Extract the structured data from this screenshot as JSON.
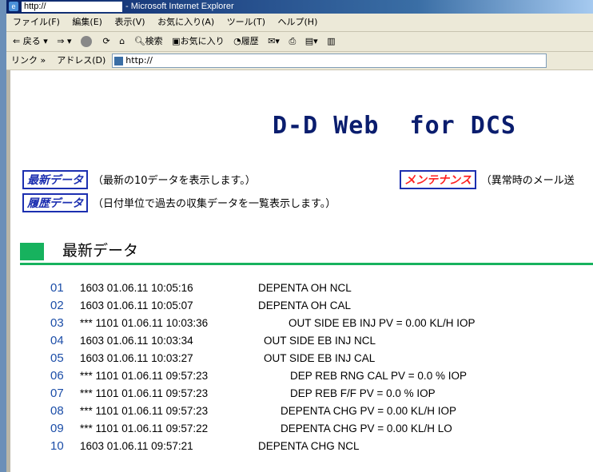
{
  "window": {
    "url": "http://",
    "app_title": "- Microsoft Internet Explorer"
  },
  "menu": [
    "ファイル(F)",
    "編集(E)",
    "表示(V)",
    "お気に入り(A)",
    "ツール(T)",
    "ヘルプ(H)"
  ],
  "toolbar": {
    "back": "戻る",
    "search": "検索",
    "favorites": "お気に入り",
    "history": "履歴"
  },
  "address": {
    "links_label": "リンク »",
    "address_label": "アドレス(D)",
    "value": "http://"
  },
  "page": {
    "brand": "D-D Web  for DCS",
    "latest_link": "最新データ",
    "latest_desc": "（最新の10データを表示します。）",
    "history_link": "履歴データ",
    "history_desc": "（日付単位で過去の収集データを一覧表示します。）",
    "maintenance_link": "メンテナンス",
    "maintenance_desc": "（異常時のメール送",
    "section_heading": "最新データ"
  },
  "rows": [
    {
      "num": "01",
      "code": "1603 01.06.11 10:05:16",
      "msg": "DEPENTA OH NCL"
    },
    {
      "num": "02",
      "code": "1603 01.06.11 10:05:07",
      "msg": "DEPENTA OH CAL"
    },
    {
      "num": "03",
      "code": "*** 1101 01.06.11 10:03:36",
      "msg": "OUT SIDE EB INJ PV = 0.00 KL/H IOP"
    },
    {
      "num": "04",
      "code": "1603 01.06.11 10:03:34",
      "msg": "OUT SIDE EB INJ NCL"
    },
    {
      "num": "05",
      "code": "1603 01.06.11 10:03:27",
      "msg": "OUT SIDE EB INJ CAL"
    },
    {
      "num": "06",
      "code": "*** 1101 01.06.11 09:57:23",
      "msg": "DEP REB RNG CAL PV = 0.0 % IOP"
    },
    {
      "num": "07",
      "code": "*** 1101 01.06.11 09:57:23",
      "msg": "DEP REB F/F PV = 0.0 % IOP"
    },
    {
      "num": "08",
      "code": "*** 1101 01.06.11 09:57:23",
      "msg": "DEPENTA CHG PV = 0.00 KL/H IOP"
    },
    {
      "num": "09",
      "code": "*** 1101 01.06.11 09:57:22",
      "msg": "DEPENTA CHG PV = 0.00 KL/H LO"
    },
    {
      "num": "10",
      "code": "1603 01.06.11 09:57:21",
      "msg": "DEPENTA CHG NCL"
    }
  ]
}
